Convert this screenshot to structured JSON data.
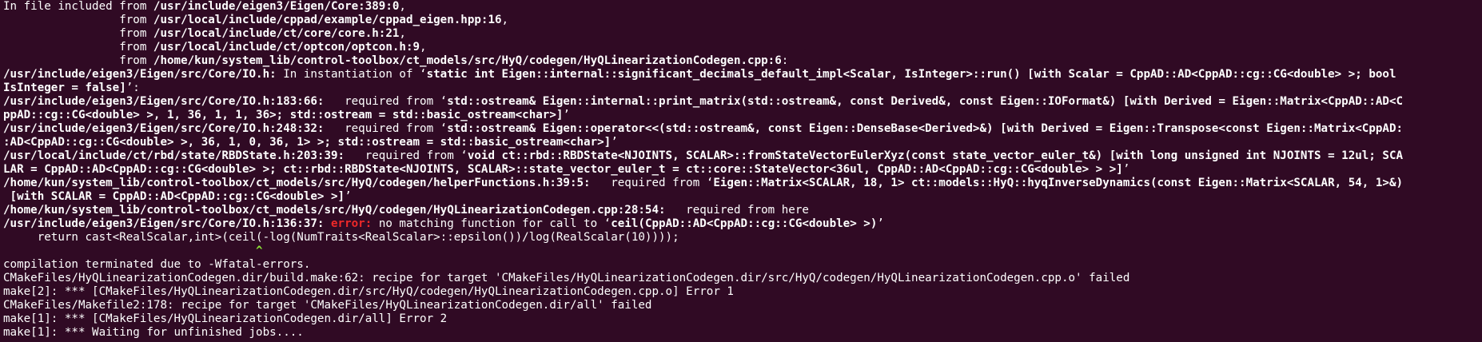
{
  "colors": {
    "background": "#300a24",
    "text": "#ffffff",
    "error": "#ef2929",
    "caret": "#8ae234"
  },
  "lines": [
    {
      "s": [
        {
          "t": "In file included from "
        },
        {
          "t": "/usr/include/eigen3/Eigen/Core:389:0",
          "c": "b"
        },
        {
          "t": ","
        }
      ]
    },
    {
      "s": [
        {
          "t": "                 from "
        },
        {
          "t": "/usr/local/include/cppad/example/cppad_eigen.hpp:16",
          "c": "b"
        },
        {
          "t": ","
        }
      ]
    },
    {
      "s": [
        {
          "t": "                 from "
        },
        {
          "t": "/usr/local/include/ct/core/core.h:21",
          "c": "b"
        },
        {
          "t": ","
        }
      ]
    },
    {
      "s": [
        {
          "t": "                 from "
        },
        {
          "t": "/usr/local/include/ct/optcon/optcon.h:9",
          "c": "b"
        },
        {
          "t": ","
        }
      ]
    },
    {
      "s": [
        {
          "t": "                 from "
        },
        {
          "t": "/home/kun/system_lib/control-toolbox/ct_models/src/HyQ/codegen/HyQLinearizationCodegen.cpp:6",
          "c": "b"
        },
        {
          "t": ":"
        }
      ]
    },
    {
      "s": [
        {
          "t": "/usr/include/eigen3/Eigen/src/Core/IO.h:",
          "c": "b"
        },
        {
          "t": " In instantiation of ‘"
        },
        {
          "t": "static int Eigen::internal::significant_decimals_default_impl<Scalar, IsInteger>::run() [with Scalar = CppAD::AD<CppAD::cg::CG<double> >; bool",
          "c": "b"
        }
      ]
    },
    {
      "s": [
        {
          "t": "IsInteger = false]",
          "c": "b"
        },
        {
          "t": "’:"
        }
      ]
    },
    {
      "s": [
        {
          "t": "/usr/include/eigen3/Eigen/src/Core/IO.h:183:66:",
          "c": "b"
        },
        {
          "t": "   required from ‘"
        },
        {
          "t": "std::ostream& Eigen::internal::print_matrix(std::ostream&, const Derived&, const Eigen::IOFormat&) [with Derived = Eigen::Matrix<CppAD::AD<C",
          "c": "b"
        }
      ]
    },
    {
      "s": [
        {
          "t": "ppAD::cg::CG<double> >, 1, 36, 1, 1, 36>; std::ostream = std::basic_ostream<char>]",
          "c": "b"
        },
        {
          "t": "’"
        }
      ]
    },
    {
      "s": [
        {
          "t": "/usr/include/eigen3/Eigen/src/Core/IO.h:248:32:",
          "c": "b"
        },
        {
          "t": "   required from ‘"
        },
        {
          "t": "std::ostream& Eigen::operator<<(std::ostream&, const Eigen::DenseBase<Derived>&) [with Derived = Eigen::Transpose<const Eigen::Matrix<CppAD:",
          "c": "b"
        }
      ]
    },
    {
      "s": [
        {
          "t": ":AD<CppAD::cg::CG<double> >, 36, 1, 0, 36, 1> >; std::ostream = std::basic_ostream<char>]",
          "c": "b"
        },
        {
          "t": "’"
        }
      ]
    },
    {
      "s": [
        {
          "t": "/usr/local/include/ct/rbd/state/RBDState.h:203:39:",
          "c": "b"
        },
        {
          "t": "   required from ‘"
        },
        {
          "t": "void ct::rbd::RBDState<NJOINTS, SCALAR>::fromStateVectorEulerXyz(const state_vector_euler_t&) [with long unsigned int NJOINTS = 12ul; SCA",
          "c": "b"
        }
      ]
    },
    {
      "s": [
        {
          "t": "LAR = CppAD::AD<CppAD::cg::CG<double> >; ct::rbd::RBDState<NJOINTS, SCALAR>::state_vector_euler_t = ct::core::StateVector<36ul, CppAD::AD<CppAD::cg::CG<double> > >]",
          "c": "b"
        },
        {
          "t": "’"
        }
      ]
    },
    {
      "s": [
        {
          "t": "/home/kun/system_lib/control-toolbox/ct_models/src/HyQ/codegen/helperFunctions.h:39:5:",
          "c": "b"
        },
        {
          "t": "   required from ‘"
        },
        {
          "t": "Eigen::Matrix<SCALAR, 18, 1> ct::models::HyQ::hyqInverseDynamics(const Eigen::Matrix<SCALAR, 54, 1>&)",
          "c": "b"
        }
      ]
    },
    {
      "s": [
        {
          "t": " [with SCALAR = CppAD::AD<CppAD::cg::CG<double> >]",
          "c": "b"
        },
        {
          "t": "’"
        }
      ]
    },
    {
      "s": [
        {
          "t": "/home/kun/system_lib/control-toolbox/ct_models/src/HyQ/codegen/HyQLinearizationCodegen.cpp:28:54:",
          "c": "b"
        },
        {
          "t": "   required from here"
        }
      ]
    },
    {
      "s": [
        {
          "t": "/usr/include/eigen3/Eigen/src/Core/IO.h:136:37:",
          "c": "b"
        },
        {
          "t": " "
        },
        {
          "t": "error: ",
          "c": "err"
        },
        {
          "t": "no matching function for call to ‘"
        },
        {
          "t": "ceil(CppAD::AD<CppAD::cg::CG<double> >)",
          "c": "b"
        },
        {
          "t": "’"
        }
      ]
    },
    {
      "s": [
        {
          "t": "     return cast<RealScalar,int>(ceil(-log(NumTraits<RealScalar>::epsilon())/log(RealScalar(10))));"
        }
      ]
    },
    {
      "s": [
        {
          "t": "                                     "
        },
        {
          "t": "^",
          "c": "caret"
        }
      ]
    },
    {
      "s": [
        {
          "t": "compilation terminated due to -Wfatal-errors."
        }
      ]
    },
    {
      "s": [
        {
          "t": "CMakeFiles/HyQLinearizationCodegen.dir/build.make:62: recipe for target 'CMakeFiles/HyQLinearizationCodegen.dir/src/HyQ/codegen/HyQLinearizationCodegen.cpp.o' failed"
        }
      ]
    },
    {
      "s": [
        {
          "t": "make[2]: *** [CMakeFiles/HyQLinearizationCodegen.dir/src/HyQ/codegen/HyQLinearizationCodegen.cpp.o] Error 1"
        }
      ]
    },
    {
      "s": [
        {
          "t": "CMakeFiles/Makefile2:178: recipe for target 'CMakeFiles/HyQLinearizationCodegen.dir/all' failed"
        }
      ]
    },
    {
      "s": [
        {
          "t": "make[1]: *** [CMakeFiles/HyQLinearizationCodegen.dir/all] Error 2"
        }
      ]
    },
    {
      "s": [
        {
          "t": "make[1]: *** Waiting for unfinished jobs...."
        }
      ]
    }
  ]
}
